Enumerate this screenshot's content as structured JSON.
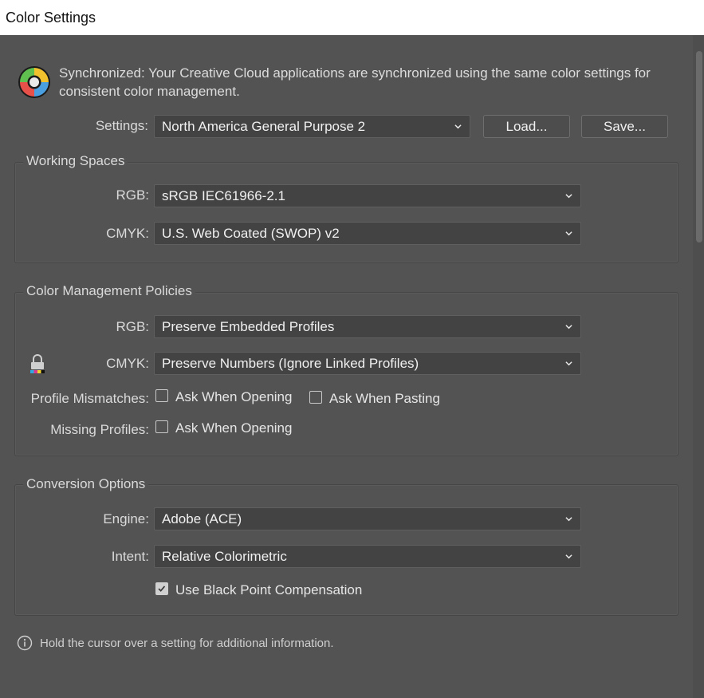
{
  "window": {
    "title": "Color Settings"
  },
  "sync": {
    "message": "Synchronized: Your Creative Cloud applications are synchronized using the same color settings for consistent color management.",
    "icon": "color-wheel-icon"
  },
  "settings": {
    "label": "Settings:",
    "value": "North America General Purpose 2",
    "load_label": "Load...",
    "save_label": "Save..."
  },
  "working_spaces": {
    "title": "Working Spaces",
    "rgb_label": "RGB:",
    "rgb_value": "sRGB IEC61966-2.1",
    "cmyk_label": "CMYK:",
    "cmyk_value": "U.S. Web Coated (SWOP) v2"
  },
  "policies": {
    "title": "Color Management Policies",
    "rgb_label": "RGB:",
    "rgb_value": "Preserve Embedded Profiles",
    "cmyk_label": "CMYK:",
    "cmyk_value": "Preserve Numbers (Ignore Linked Profiles)",
    "lock_icon": "lock-icon",
    "mismatch_label": "Profile Mismatches:",
    "mismatch_opening": {
      "label": "Ask When Opening",
      "checked": false
    },
    "mismatch_pasting": {
      "label": "Ask When Pasting",
      "checked": false
    },
    "missing_label": "Missing Profiles:",
    "missing_opening": {
      "label": "Ask When Opening",
      "checked": false
    }
  },
  "conversion": {
    "title": "Conversion Options",
    "engine_label": "Engine:",
    "engine_value": "Adobe (ACE)",
    "intent_label": "Intent:",
    "intent_value": "Relative Colorimetric",
    "bpc": {
      "label": "Use Black Point Compensation",
      "checked": true
    }
  },
  "hint": {
    "icon": "info-icon",
    "text": "Hold the cursor over a setting for additional information."
  },
  "colors": {
    "background": "#535353",
    "field": "#434343",
    "titlebar": "#ffffff"
  }
}
